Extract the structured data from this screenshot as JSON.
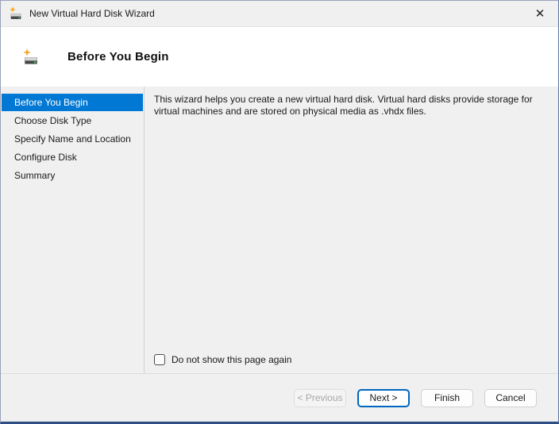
{
  "window": {
    "title": "New Virtual Hard Disk Wizard"
  },
  "icons": {
    "close": "✕"
  },
  "header": {
    "title": "Before You Begin"
  },
  "sidebar": {
    "items": [
      {
        "label": "Before You Begin",
        "selected": true
      },
      {
        "label": "Choose Disk Type",
        "selected": false
      },
      {
        "label": "Specify Name and Location",
        "selected": false
      },
      {
        "label": "Configure Disk",
        "selected": false
      },
      {
        "label": "Summary",
        "selected": false
      }
    ]
  },
  "main": {
    "description": "This wizard helps you create a new virtual hard disk. Virtual hard disks provide storage for virtual machines and are stored on physical media as .vhdx files.",
    "checkbox_label": "Do not show this page again",
    "checkbox_checked": false
  },
  "footer": {
    "buttons": [
      {
        "label": "< Previous",
        "state": "disabled"
      },
      {
        "label": "Next >",
        "state": "default"
      },
      {
        "label": "Finish",
        "state": "normal"
      },
      {
        "label": "Cancel",
        "state": "normal"
      }
    ]
  },
  "colors": {
    "accent": "#0078d4",
    "selected_item_background": "#0078d4",
    "default_button_border": "#0067c0",
    "window_bottom_border": "#2e4d85",
    "header_background": "#ffffff",
    "body_background": "#f0f0f0",
    "disk_icon_star": "#f5a623",
    "disk_icon_led": "#3ed23e"
  }
}
